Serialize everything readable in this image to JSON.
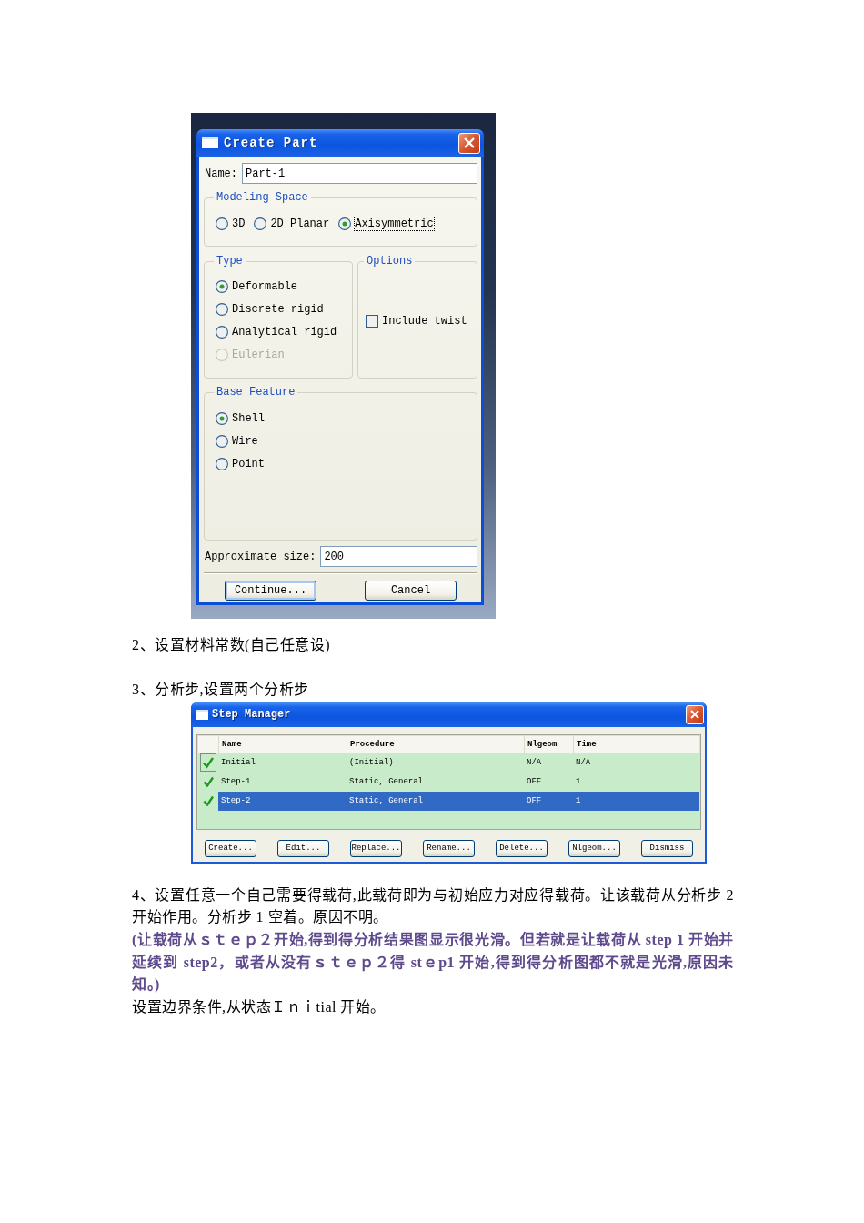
{
  "create_part_dialog": {
    "title": "Create Part",
    "name_field": {
      "label": "Name:",
      "value": "Part-1"
    },
    "modeling_space": {
      "title": "Modeling Space",
      "options": [
        {
          "label": "3D",
          "selected": false,
          "focused": false
        },
        {
          "label": "2D Planar",
          "selected": false,
          "focused": false
        },
        {
          "label": "Axisymmetric",
          "selected": true,
          "focused": true
        }
      ]
    },
    "type": {
      "title": "Type",
      "options": [
        {
          "label": "Deformable",
          "selected": true,
          "disabled": false
        },
        {
          "label": "Discrete rigid",
          "selected": false,
          "disabled": false
        },
        {
          "label": "Analytical rigid",
          "selected": false,
          "disabled": false
        },
        {
          "label": "Eulerian",
          "selected": false,
          "disabled": true
        }
      ]
    },
    "options": {
      "title": "Options",
      "checkboxes": [
        {
          "label": "Include twist",
          "checked": false
        }
      ]
    },
    "base_feature": {
      "title": "Base Feature",
      "options": [
        {
          "label": "Shell",
          "selected": true
        },
        {
          "label": "Wire",
          "selected": false
        },
        {
          "label": "Point",
          "selected": false
        }
      ]
    },
    "approximate_size": {
      "label": "Approximate size:",
      "value": "200"
    },
    "buttons": [
      {
        "label": "Continue...",
        "default": true
      },
      {
        "label": "Cancel",
        "default": false
      }
    ]
  },
  "paragraphs_1": [
    {
      "kind": "body",
      "text": "2、设置材料常数(自己任意设)"
    },
    {
      "kind": "body",
      "text": "3、分析步,设置两个分析步"
    }
  ],
  "step_manager": {
    "title": "Step Manager",
    "columns": [
      "Name",
      "Procedure",
      "Nlgeom",
      "Time"
    ],
    "rows": [
      {
        "name": "Initial",
        "procedure": "(Initial)",
        "nlgeom": "N/A",
        "time": "N/A",
        "valid": true,
        "selected": false,
        "focused": true
      },
      {
        "name": "Step-1",
        "procedure": "Static, General",
        "nlgeom": "OFF",
        "time": "1",
        "valid": true,
        "selected": false,
        "focused": false
      },
      {
        "name": "Step-2",
        "procedure": "Static, General",
        "nlgeom": "OFF",
        "time": "1",
        "valid": true,
        "selected": true,
        "focused": false
      }
    ],
    "buttons": [
      "Create...",
      "Edit...",
      "Replace...",
      "Rename...",
      "Delete...",
      "Nlgeom...",
      "Dismiss"
    ]
  },
  "paragraphs_2": [
    {
      "kind": "body",
      "text": "4、设置任意一个自己需要得载荷,此载荷即为与初始应力对应得载荷。让该载荷从分析步 2 开始作用。分析步 1 空着。原因不明。"
    },
    {
      "kind": "note",
      "text": "(让载荷从ｓｔｅｐ２开始,得到得分析结果图显示很光滑。但若就是让载荷从 step 1 开始并延续到 step2，或者从没有ｓｔｅｐ２得 stｅp1 开始,得到得分析图都不就是光滑,原因未知。)"
    },
    {
      "kind": "body",
      "text": "设置边界条件,从状态Ｉｎｉtial 开始。"
    }
  ]
}
